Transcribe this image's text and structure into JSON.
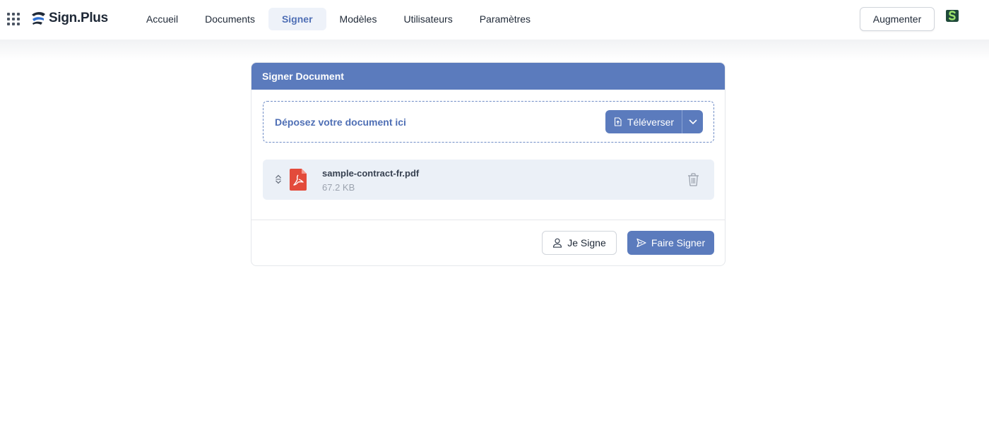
{
  "header": {
    "logo_text": "Sign.Plus",
    "nav": [
      {
        "label": "Accueil",
        "active": false
      },
      {
        "label": "Documents",
        "active": false
      },
      {
        "label": "Signer",
        "active": true
      },
      {
        "label": "Modèles",
        "active": false
      },
      {
        "label": "Utilisateurs",
        "active": false
      },
      {
        "label": "Paramètres",
        "active": false
      }
    ],
    "upgrade_label": "Augmenter"
  },
  "card": {
    "title": "Signer Document",
    "dropzone_text": "Déposez votre document ici",
    "upload_label": "Téléverser",
    "file": {
      "name": "sample-contract-fr.pdf",
      "size": "67.2 KB"
    },
    "me_sign_label": "Je Signe",
    "send_sign_label": "Faire Signer"
  },
  "colors": {
    "accent": "#5b7bbd",
    "accent_text": "#4f6fb5",
    "file_row_bg": "#ebf0f7",
    "pdf_red": "#e34b3b"
  },
  "icons": [
    "apps-grid-icon",
    "logo-icon",
    "avatar-icon",
    "file-upload-icon",
    "chevron-down-icon",
    "drag-handle-icon",
    "pdf-file-icon",
    "trash-icon",
    "user-icon",
    "send-icon"
  ]
}
